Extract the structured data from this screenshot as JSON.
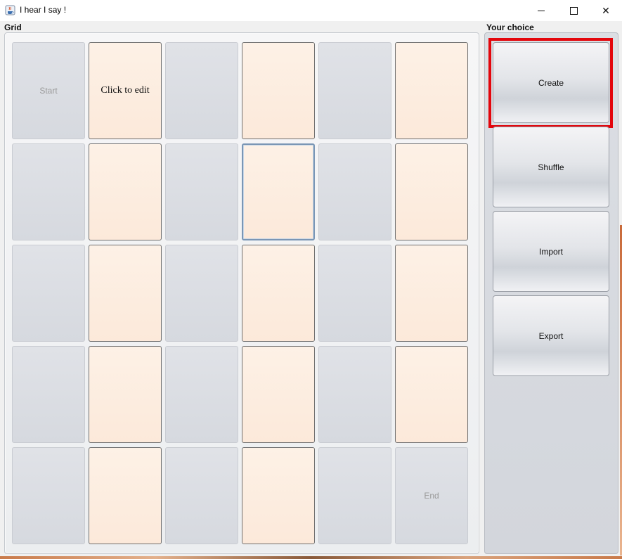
{
  "window": {
    "title": "I hear I say !",
    "controls": {
      "minimize": "minimize",
      "maximize": "maximize",
      "close": "✕"
    }
  },
  "grid": {
    "label": "Grid",
    "rows": [
      [
        {
          "type": "blue",
          "text": "Start"
        },
        {
          "type": "peach",
          "text": "Click to edit"
        },
        {
          "type": "blue",
          "text": ""
        },
        {
          "type": "peach",
          "text": ""
        },
        {
          "type": "blue",
          "text": ""
        },
        {
          "type": "peach",
          "text": ""
        }
      ],
      [
        {
          "type": "blue",
          "text": ""
        },
        {
          "type": "peach",
          "text": ""
        },
        {
          "type": "blue",
          "text": ""
        },
        {
          "type": "peach",
          "text": "",
          "focused": true
        },
        {
          "type": "blue",
          "text": ""
        },
        {
          "type": "peach",
          "text": ""
        }
      ],
      [
        {
          "type": "blue",
          "text": ""
        },
        {
          "type": "peach",
          "text": ""
        },
        {
          "type": "blue",
          "text": ""
        },
        {
          "type": "peach",
          "text": ""
        },
        {
          "type": "blue",
          "text": ""
        },
        {
          "type": "peach",
          "text": ""
        }
      ],
      [
        {
          "type": "blue",
          "text": ""
        },
        {
          "type": "peach",
          "text": ""
        },
        {
          "type": "blue",
          "text": ""
        },
        {
          "type": "peach",
          "text": ""
        },
        {
          "type": "blue",
          "text": ""
        },
        {
          "type": "peach",
          "text": ""
        }
      ],
      [
        {
          "type": "blue",
          "text": ""
        },
        {
          "type": "peach",
          "text": ""
        },
        {
          "type": "blue",
          "text": ""
        },
        {
          "type": "peach",
          "text": ""
        },
        {
          "type": "blue",
          "text": ""
        },
        {
          "type": "blue",
          "text": "End"
        }
      ]
    ]
  },
  "choice": {
    "label": "Your choice",
    "buttons": [
      {
        "label": "Create",
        "highlighted": true
      },
      {
        "label": "Shuffle"
      },
      {
        "label": "Import"
      },
      {
        "label": "Export"
      }
    ],
    "highlight_color": "#e3060c"
  }
}
